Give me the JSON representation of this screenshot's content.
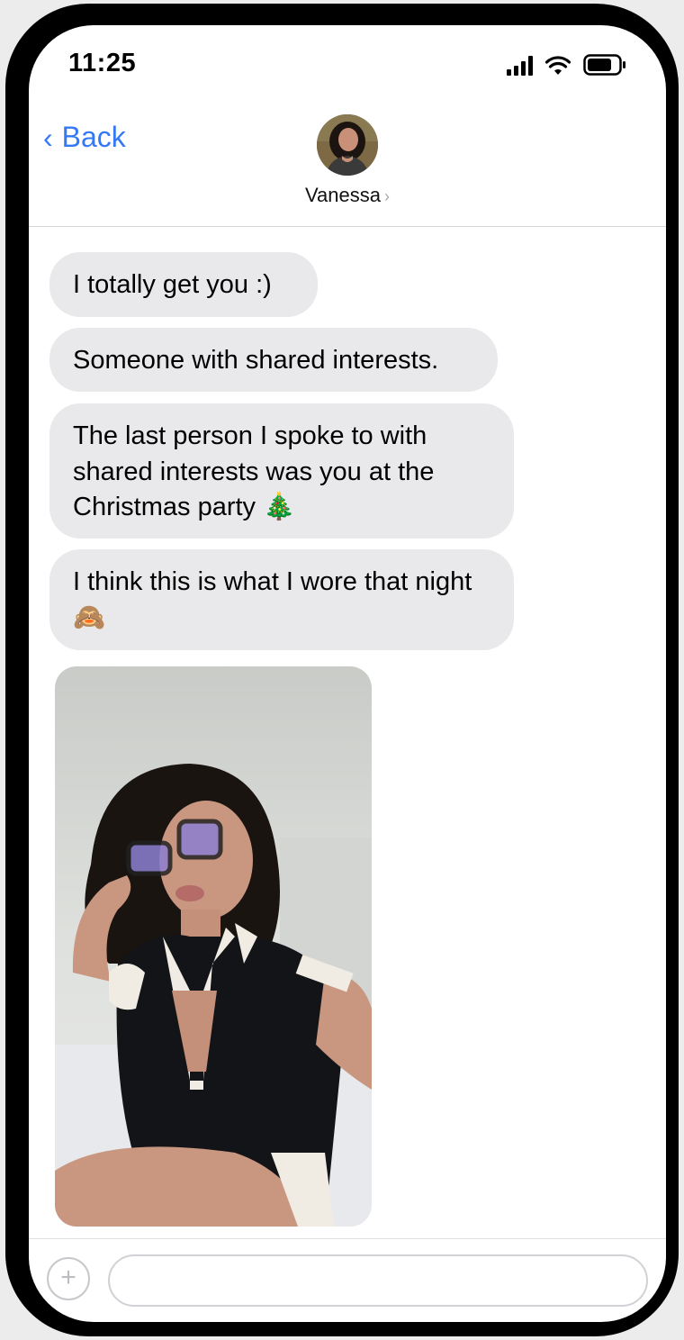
{
  "status_bar": {
    "time": "11:25",
    "icons": [
      "signal-icon",
      "wifi-icon",
      "battery-icon"
    ]
  },
  "header": {
    "back_label": "Back",
    "contact_name": "Vanessa",
    "name_chevron": "›",
    "avatar_icon": "contact-avatar-photo"
  },
  "messages": [
    {
      "text": "I totally get you :)"
    },
    {
      "text": "Someone with shared interests."
    },
    {
      "text": "The last person I spoke to with shared interests was you at the Christmas party 🎄"
    },
    {
      "text": "I think this is what I wore that night 🙈"
    }
  ],
  "photo_message": {
    "icon": "photo-attachment"
  },
  "composer": {
    "add_icon": "+",
    "input_value": "",
    "input_placeholder": ""
  },
  "colors": {
    "accent": "#3478f6",
    "bubble_incoming": "#e9e9eb",
    "frame": "#000000"
  }
}
